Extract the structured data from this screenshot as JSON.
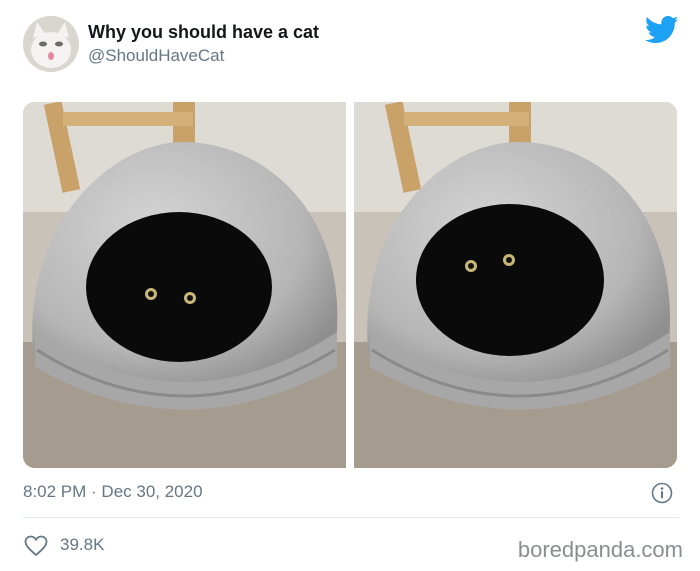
{
  "tweet": {
    "display_name": "Why you should have a cat",
    "handle": "@ShouldHaveCat",
    "timestamp": "8:02 PM · Dec 30, 2020",
    "likes": "39.8K"
  },
  "icons": {
    "brand": "twitter-bird-icon",
    "info": "info-icon",
    "like": "heart-icon"
  },
  "colors": {
    "twitter_blue": "#1da1f2",
    "secondary_text": "#657786",
    "border": "#e1e8ed"
  },
  "watermark": "boredpanda.com"
}
